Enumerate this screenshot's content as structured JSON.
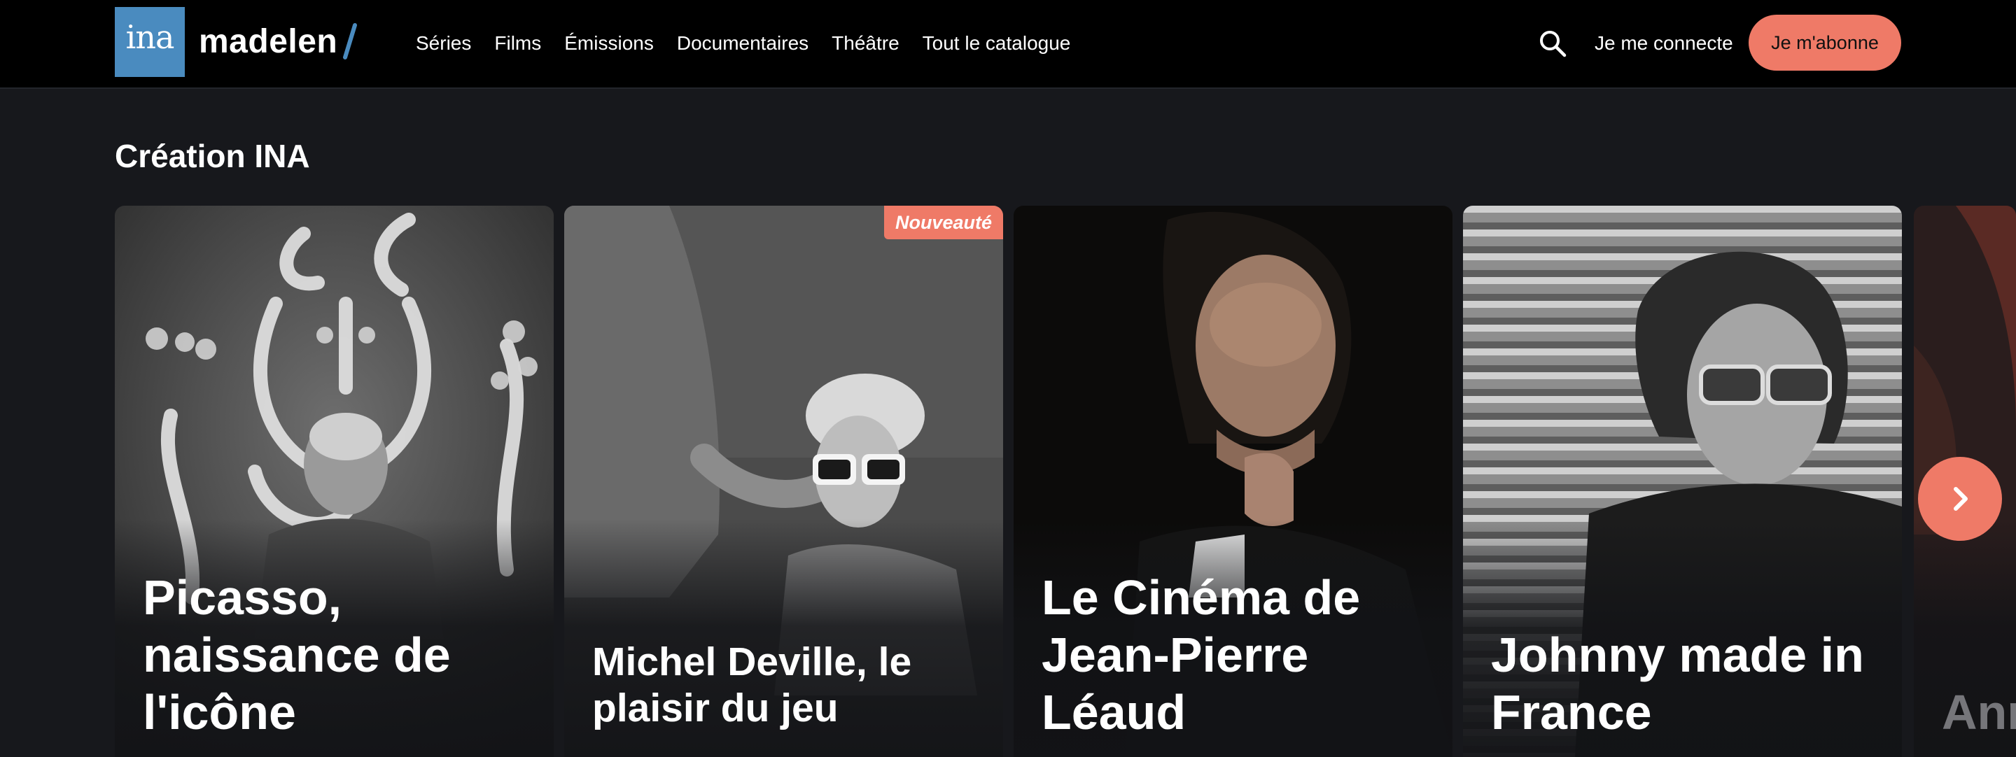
{
  "header": {
    "logo_text": "ina",
    "brand": "madelen",
    "nav": [
      "Séries",
      "Films",
      "Émissions",
      "Documentaires",
      "Théâtre",
      "Tout le catalogue"
    ],
    "login": "Je me connecte",
    "subscribe": "Je m'abonne",
    "icons": {
      "search": "search-icon",
      "next": "chevron-right-icon"
    }
  },
  "section": {
    "title": "Création INA",
    "cards": [
      {
        "title": "Picasso, naissance de l'icône"
      },
      {
        "title": "Michel Deville, le plaisir du jeu",
        "badge": "Nouveauté"
      },
      {
        "title": "Le Cinéma de Jean-Pierre Léaud"
      },
      {
        "title": "Johnny made in France"
      },
      {
        "title": "Ann sou"
      }
    ]
  },
  "colors": {
    "accent": "#ef7a67",
    "logo_blue": "#4a8bbf",
    "header_bg": "#000000",
    "page_bg": "#17181c"
  }
}
